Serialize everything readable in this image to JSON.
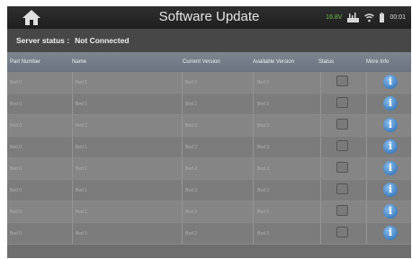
{
  "header": {
    "title": "Software Update",
    "home_icon": "home-icon",
    "voltage": "16.8V",
    "time": "00:01",
    "icons": [
      "modem-icon",
      "wifi-icon",
      "battery-icon"
    ]
  },
  "server": {
    "label": "Server status :",
    "value": "Not Connected"
  },
  "table": {
    "columns": [
      "Part Number",
      "Name",
      "Current Version",
      "Available Version",
      "Status",
      "More Info"
    ],
    "rows": [
      [
        "Bed 0",
        "Bed 1",
        "Bed 2",
        "Bed 2"
      ],
      [
        "Bed 0",
        "Bed 1",
        "Bed 2",
        "Bed 3"
      ],
      [
        "Bed 0",
        "Bed 1",
        "Bed 2",
        "Bed 3"
      ],
      [
        "Bed 0",
        "Bed 1",
        "Bed 2",
        "Bed 3"
      ],
      [
        "Bed 0",
        "Bed 1",
        "Bed 2",
        "Bed 3"
      ],
      [
        "Bed 0",
        "Bed 1",
        "Bed 2",
        "Bed 3"
      ],
      [
        "Bed 0",
        "Bed 1",
        "Bed 2",
        "Bed 3"
      ],
      [
        "Bed 0",
        "Bed 1",
        "Bed 2",
        "Bed 3"
      ]
    ],
    "info_glyph": "i"
  },
  "colors": {
    "voltage": "#6cc04a",
    "info": "#3f7fc1",
    "header_bar": "#2f2f2f"
  }
}
